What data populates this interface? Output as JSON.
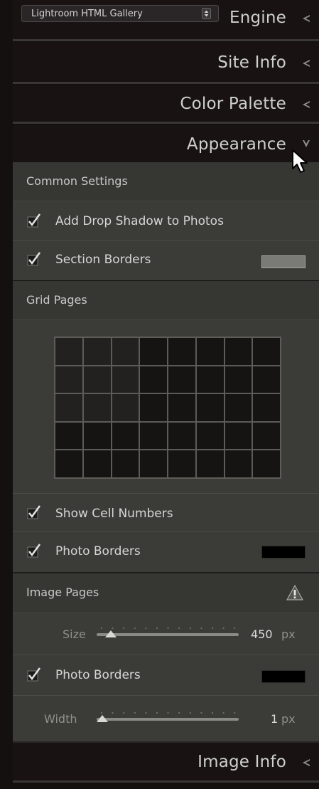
{
  "engine": {
    "selected": "Lightroom HTML Gallery",
    "title": "Engine"
  },
  "panels": {
    "site_info": "Site Info",
    "color_palette": "Color Palette",
    "appearance": "Appearance",
    "image_info": "Image Info"
  },
  "common": {
    "heading": "Common Settings",
    "drop_shadow": {
      "label": "Add Drop Shadow to Photos",
      "checked": true
    },
    "section_borders": {
      "label": "Section Borders",
      "checked": true,
      "color": "#7a7a77"
    }
  },
  "grid_pages": {
    "heading": "Grid Pages",
    "columns": 8,
    "rows": 5,
    "selected_columns": 3,
    "selected_rows": 3,
    "show_cell_numbers": {
      "label": "Show Cell Numbers",
      "checked": true
    },
    "photo_borders": {
      "label": "Photo Borders",
      "checked": true,
      "color": "#000000"
    }
  },
  "image_pages": {
    "heading": "Image Pages",
    "warning_icon": "warning-icon",
    "size": {
      "label": "Size",
      "value": "450",
      "unit": "px",
      "fraction": 0.06
    },
    "photo_borders": {
      "label": "Photo Borders",
      "checked": true,
      "color": "#000000"
    },
    "width": {
      "label": "Width",
      "value": "1",
      "unit": "px",
      "fraction": 0.0
    }
  },
  "colors": {
    "panel_bg": "#3b3b37",
    "header_bg": "#181213",
    "text": "#d6d6d6"
  }
}
